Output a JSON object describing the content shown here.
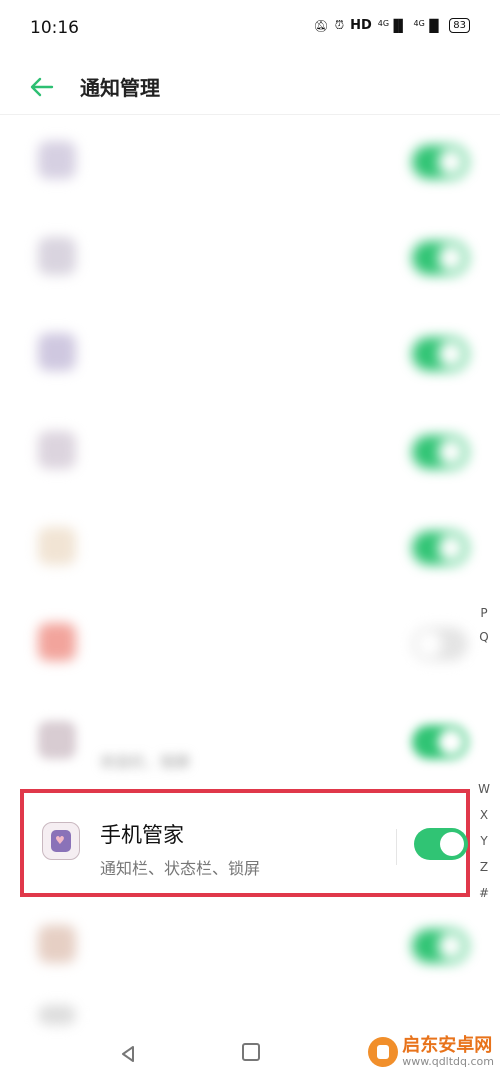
{
  "status_bar": {
    "time": "10:16",
    "hd_label": "HD",
    "signal_label": "4G",
    "signal2_label": "4G",
    "battery": "83"
  },
  "header": {
    "title": "通知管理"
  },
  "apps": [
    {
      "name": "",
      "sub": "",
      "enabled": true
    },
    {
      "name": "",
      "sub": "",
      "enabled": true
    },
    {
      "name": "",
      "sub": "",
      "enabled": true
    },
    {
      "name": "",
      "sub": "",
      "enabled": true
    },
    {
      "name": "",
      "sub": "",
      "enabled": true
    },
    {
      "name": "",
      "sub": "",
      "enabled": false
    },
    {
      "name": "",
      "sub": "状态栏、锁屏",
      "enabled": true
    },
    {
      "name": "手机管家",
      "sub": "通知栏、状态栏、锁屏",
      "enabled": true
    },
    {
      "name": "",
      "sub": "",
      "enabled": true
    }
  ],
  "index_bar": [
    "P",
    "Q",
    "W",
    "X",
    "Y",
    "Z",
    "#"
  ],
  "watermark": {
    "title": "启东安卓网",
    "url": "www.qdltdq.com"
  },
  "colors": {
    "toggle_on": "#30c474",
    "highlight": "#e0384a",
    "accent_back": "#2dbf72"
  }
}
